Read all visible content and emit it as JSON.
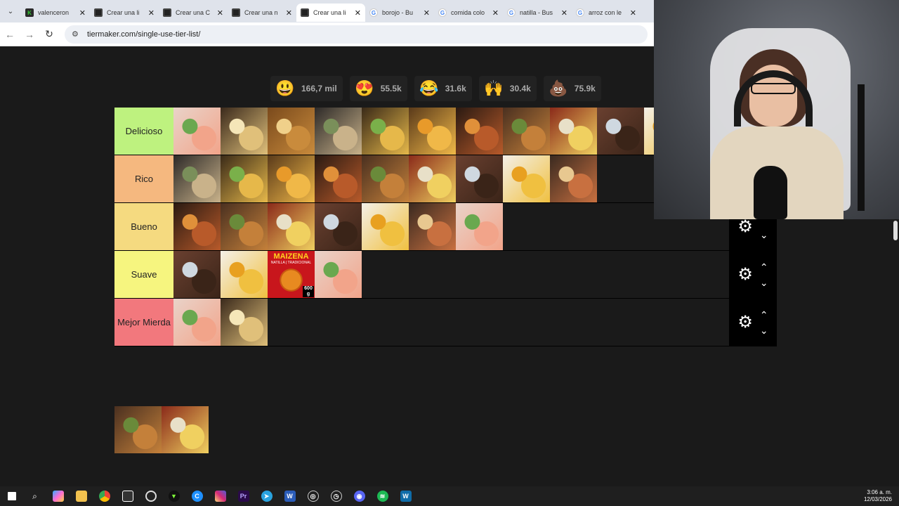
{
  "browser": {
    "tabs": [
      {
        "title": "valenceron",
        "icon": "kick-icon",
        "active": false
      },
      {
        "title": "Crear una li",
        "icon": "tiermaker-icon",
        "active": false
      },
      {
        "title": "Crear una C",
        "icon": "tiermaker-icon",
        "active": false
      },
      {
        "title": "Crear una n",
        "icon": "tiermaker-icon",
        "active": false
      },
      {
        "title": "Crear una li",
        "icon": "tiermaker-icon",
        "active": true
      },
      {
        "title": "borojo - Bu",
        "icon": "google-icon",
        "active": false
      },
      {
        "title": "comida colo",
        "icon": "google-icon",
        "active": false
      },
      {
        "title": "natilla - Bus",
        "icon": "google-icon",
        "active": false
      },
      {
        "title": "arroz con le",
        "icon": "google-icon",
        "active": false
      }
    ],
    "url": "tiermaker.com/single-use-tier-list/"
  },
  "reactions": [
    {
      "emoji": "😃",
      "count": "166,7 mil"
    },
    {
      "emoji": "😍",
      "count": "55.5k"
    },
    {
      "emoji": "😂",
      "count": "31.6k"
    },
    {
      "emoji": "🙌",
      "count": "30.4k"
    },
    {
      "emoji": "💩",
      "count": "75.9k"
    }
  ],
  "tiers": [
    {
      "label": "Delicioso",
      "color": "#bef27f",
      "items": [
        "shrimp-cocktail",
        "arepa-sandwich",
        "fried-chicken",
        "toasted-sandwich",
        "fried-plantains",
        "pandebono",
        "tamal-stew",
        "picada-platter",
        "cake-dessert",
        "hot-chocolate",
        "lemonade"
      ]
    },
    {
      "label": "Rico",
      "color": "#f5b87f",
      "items": [
        "bandeja-paisa",
        "sancocho",
        "ajiaco",
        "pulled-pork",
        "tamales",
        "bread-basket",
        "natilla-bowl",
        "cheese-guava",
        "cappuccino"
      ]
    },
    {
      "label": "Bueno",
      "color": "#f5da80",
      "items": [
        "yuca-sandwich",
        "chocolate-cup",
        "corn-drink",
        "rice-pudding",
        "chicharron-plate",
        "waffles",
        "cholado"
      ]
    },
    {
      "label": "Suave",
      "color": "#f6f57f",
      "items": [
        "peanuts",
        "borojo",
        "maizena-natilla",
        "changua"
      ]
    },
    {
      "label": "Mejor Mierda",
      "color": "#f2787d",
      "items": [
        "lulada-drink",
        "morcilla"
      ]
    }
  ],
  "pool": [
    "ajiaco-bowl",
    "sancocho-pot"
  ],
  "maizena": {
    "brand": "MAIZENA",
    "sub": "NATILLA | TRADICIONAL",
    "weight": "600 g"
  },
  "clock": {
    "time": "3:06 a. m.",
    "date": "12/03/2026"
  }
}
